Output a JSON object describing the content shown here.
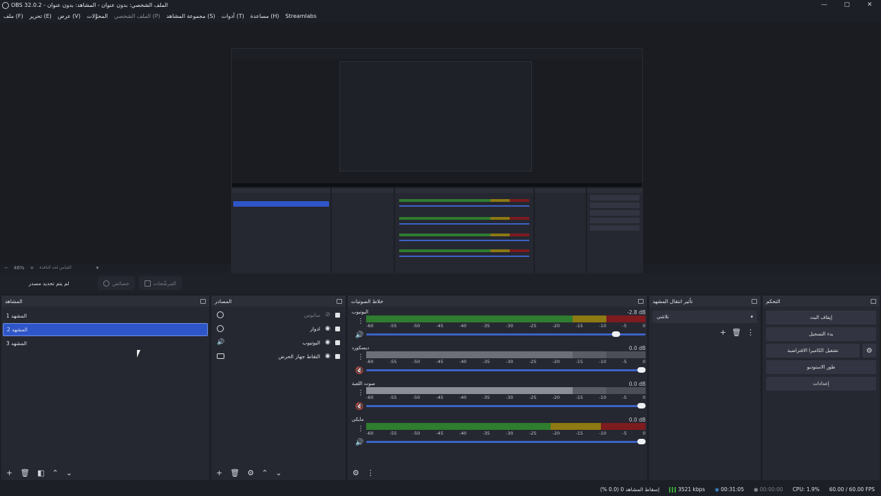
{
  "window": {
    "title": "OBS 32.0.2 - الملف الشخصي: بدون عنوان - المشاهد: بدون عنوان",
    "minimize": "—",
    "maximize": "▢",
    "close": "✕"
  },
  "menu": [
    "ملف (F)",
    "تحرير (E)",
    "عرض (V)",
    "المحوَّلات",
    "الملف الشخصي (P)",
    "مجموعة المشاهد (S)",
    "أدوات (T)",
    "مساعدة (H)",
    "Streamlabs"
  ],
  "zoom": {
    "minus": "−",
    "value": "46%",
    "plus": "+",
    "label": "القياس لحد النافذة",
    "chevron": "▾"
  },
  "source_toolbar": {
    "status": "لم يتم تحديد مصدر",
    "properties": "خصائص",
    "filters": "المرشّحات"
  },
  "scenes": {
    "title": "المشاهد",
    "items": [
      "المشهد 1",
      "المشهد 2",
      "المشهد 3"
    ],
    "selected_index": 1
  },
  "sources": {
    "title": "المصادر",
    "items": [
      {
        "name": "ساتوس",
        "icon": "globe-icon",
        "hidden": true
      },
      {
        "name": "ادوار",
        "icon": "globe-icon",
        "hidden": false
      },
      {
        "name": "اليوتيوب",
        "icon": "speaker-icon",
        "hidden": false
      },
      {
        "name": "التقاط جهاز الحرض",
        "icon": "display-icon",
        "hidden": false
      }
    ]
  },
  "mixer": {
    "title": "خلاط الصوتيات",
    "ticks": [
      "-60",
      "-55",
      "-50",
      "-45",
      "-40",
      "-35",
      "-30",
      "-25",
      "-20",
      "-15",
      "-10",
      "-5",
      "0"
    ],
    "channels": [
      {
        "name": "اليوتيوب",
        "db": "-2.8 dB",
        "muted": false,
        "level": 0.92
      },
      {
        "name": "ديسكورد",
        "db": "0.0 dB",
        "muted": true,
        "level": 1.0
      },
      {
        "name": "صوت اللعبة",
        "db": "0.0 dB",
        "muted": true,
        "level": 1.0
      },
      {
        "name": "مايكي",
        "db": "0.0 dB",
        "muted": false,
        "level": 1.0
      }
    ]
  },
  "transitions": {
    "title": "تأثير انتقال المشهد",
    "selected": "تلاشي"
  },
  "controls": {
    "title": "التحكم",
    "buttons": [
      "إيقاف البث",
      "بدء التسجيل",
      "تشغيل الكاميرا الافتراضية",
      "طور الاستوديو",
      "إعدادات"
    ]
  },
  "status": {
    "dropped": "إسقاط المشاهد 0 (0.0 %)",
    "bitrate": "3521 kbps",
    "live_time": "00:31:05",
    "rec_time": "00:00:00",
    "cpu": "CPU: 1.9%",
    "fps": "60.00 / 60.00 FPS"
  },
  "colors": {
    "accent": "#2f56c9",
    "meter_green": "#2f7d2f",
    "meter_yellow": "#8d7a12",
    "meter_red": "#7d1b1f",
    "fader": "#3d63c8"
  }
}
